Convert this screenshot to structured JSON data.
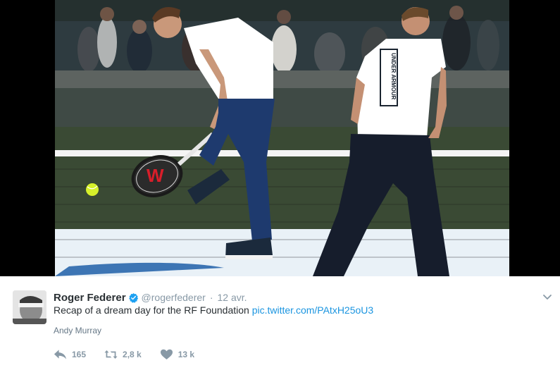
{
  "tweet": {
    "display_name": "Roger Federer",
    "handle": "@rogerfederer",
    "separator": "·",
    "timestamp": "12 avr.",
    "text": "Recap of a dream day for the RF Foundation",
    "link": "pic.twitter.com/PAtxH25oU3",
    "tagged_user": "Andy Murray",
    "actions": {
      "reply": {
        "icon": "reply-icon",
        "count": "165"
      },
      "retweet": {
        "icon": "retweet-icon",
        "count": "2,8 k"
      },
      "like": {
        "icon": "heart-icon",
        "count": "13 k"
      }
    },
    "caret_icon": "chevron-down-icon",
    "verified_icon": "verified-badge-icon"
  },
  "media": {
    "shirt_text": "UNDER ARMOUR"
  },
  "colors": {
    "link": "#1b95e0",
    "verified": "#1da1f2",
    "muted": "#8899a6",
    "text": "#292f33"
  }
}
